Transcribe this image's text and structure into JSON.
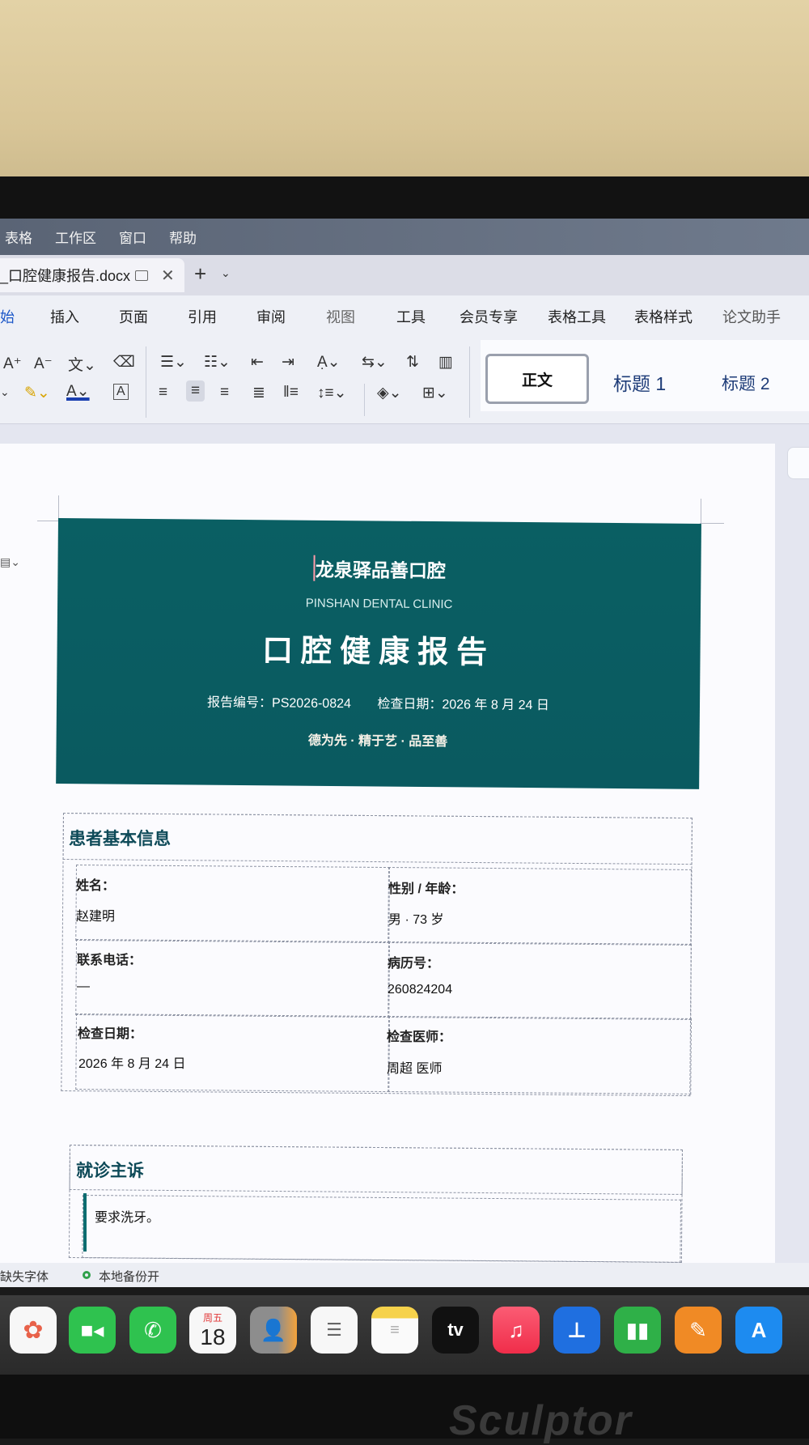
{
  "menubar": [
    "表格",
    "工作区",
    "窗口",
    "帮助"
  ],
  "doc_tab": {
    "title": "_口腔健康报告.docx"
  },
  "ribbon_tabs": [
    "始",
    "插入",
    "页面",
    "引用",
    "审阅",
    "视图",
    "工具",
    "会员专享",
    "表格工具",
    "表格样式",
    "论文助手"
  ],
  "styles": {
    "normal": "正文",
    "h1": "标题 1",
    "h2": "标题 2"
  },
  "banner": {
    "clinic": "龙泉驿品善口腔",
    "clinic_en": "PINSHAN DENTAL CLINIC",
    "title": "口腔健康报告",
    "report_no": "报告编号：PS2026-0824",
    "exam_date": "检查日期：2026 年 8 月 24 日",
    "motto": "德为先 · 精于艺 · 品至善"
  },
  "patient": {
    "heading": "患者基本信息",
    "name_label": "姓名：",
    "name": "赵建明",
    "gender_age_label": "性别 / 年龄：",
    "gender_age": "男 · 73 岁",
    "phone_label": "联系电话：",
    "phone": "—",
    "record_label": "病历号：",
    "record": "260824204",
    "date_label": "检查日期：",
    "date": "2026 年 8 月 24 日",
    "doctor_label": "检查医师：",
    "doctor": "周超 医师"
  },
  "complaint": {
    "heading": "就诊主诉",
    "text": "要求洗牙。"
  },
  "status": {
    "missing_font": "缺失字体",
    "backup": "本地备份开"
  },
  "dock": {
    "calendar_weekday": "周五",
    "calendar_day": "18",
    "tv": "tv"
  },
  "bezel_brand": "Sculptor"
}
